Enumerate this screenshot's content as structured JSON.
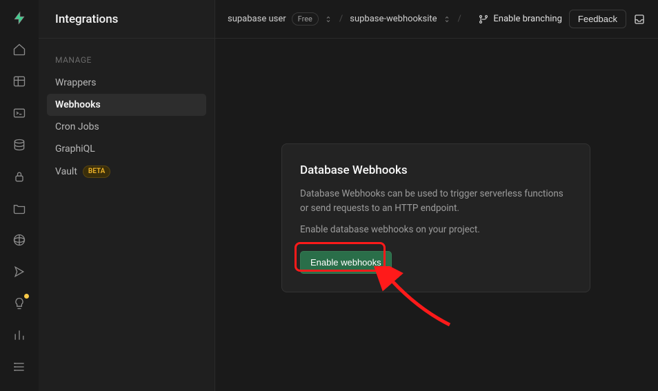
{
  "sidebar": {
    "title": "Integrations",
    "section_label": "MANAGE",
    "items": [
      {
        "label": "Wrappers"
      },
      {
        "label": "Webhooks"
      },
      {
        "label": "Cron Jobs"
      },
      {
        "label": "GraphiQL"
      },
      {
        "label": "Vault",
        "badge": "BETA"
      }
    ],
    "active_index": 1
  },
  "topbar": {
    "org_name": "supabase user",
    "plan_label": "Free",
    "project_name": "supbase-webhooksite",
    "branching_label": "Enable branching",
    "feedback_label": "Feedback"
  },
  "card": {
    "title": "Database Webhooks",
    "description": "Database Webhooks can be used to trigger serverless functions or send requests to an HTTP endpoint.",
    "hint": "Enable database webhooks on your project.",
    "button_label": "Enable webhooks"
  },
  "colors": {
    "accent": "#2a6e49",
    "highlight": "#ff1a1a"
  }
}
